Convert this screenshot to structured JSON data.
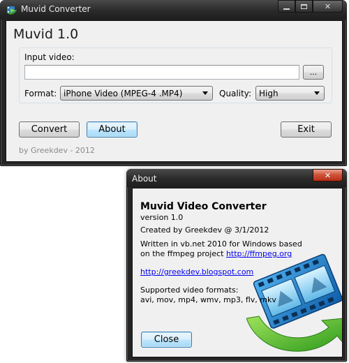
{
  "main_window": {
    "title": "Muvid Converter",
    "heading": "Muvid 1.0",
    "input_label": "Input video:",
    "input_value": "",
    "browse_label": "...",
    "format_label": "Format:",
    "format_value": "iPhone Video (MPEG-4 .MP4)",
    "quality_label": "Quality:",
    "quality_value": "High",
    "convert_label": "Convert",
    "about_label": "About",
    "exit_label": "Exit",
    "footer": "by Greekdev - 2012"
  },
  "about_window": {
    "title": "About",
    "app_name": "Muvid Video Converter",
    "version": "version 1.0",
    "created_by": "Created by Greekdev @ 3/1/2012",
    "written_line1": "Written in vb.net 2010 for Windows based",
    "written_line2_prefix": "on the ffmpeg project ",
    "ffmpeg_link": "http://ffmpeg.org",
    "blog_link": "http://greekdev.blogspot.com",
    "formats_heading": "Supported video formats:",
    "formats_list": "avi, mov, mp4, wmv, mp3, flv, mkv",
    "close_label": "Close"
  },
  "colors": {
    "frame": "#262626",
    "client": "#f0f0f0",
    "close_red": "#c7452c",
    "link": "#0000ee"
  },
  "icons": {
    "app_icon": "muvid-app-icon",
    "about_graphic": "film-strip-graphic"
  }
}
